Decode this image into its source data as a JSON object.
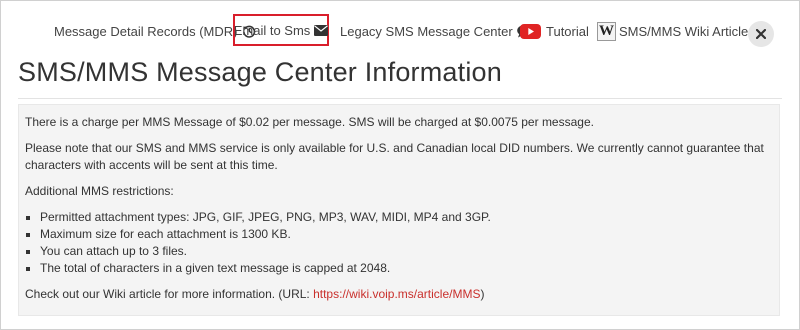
{
  "toolbar": {
    "mdr_label": "Message Detail Records (MDR)",
    "email_label": "Email to Sms",
    "legacy_label": "Legacy SMS Message Center",
    "tutorial_label": "Tutorial",
    "wiki_label": "SMS/MMS Wiki Article",
    "wiki_logo_letter": "W",
    "icons": {
      "mdr": "history-icon",
      "email": "envelope-icon",
      "legacy": "chat-bubble-icon",
      "tutorial": "youtube-icon",
      "wiki": "wikipedia-icon",
      "close": "close-icon"
    },
    "highlight_color": "#d91e2b"
  },
  "page": {
    "title": "SMS/MMS Message Center Information"
  },
  "info": {
    "charge_text": "There is a charge per MMS Message of $0.02 per message. SMS will be charged at $0.0075 per message.",
    "availability_text": "Please note that our SMS and MMS service is only available for U.S. and Canadian local DID numbers. We currently cannot guarantee that characters with accents will be sent at this time.",
    "restrictions_heading": "Additional MMS restrictions:",
    "restrictions": [
      "Permitted attachment types: JPG, GIF, JPEG, PNG, MP3, WAV, MIDI, MP4 and 3GP.",
      "Maximum size for each attachment is 1300 KB.",
      "You can attach up to 3 files.",
      "The total of characters in a given text message is capped at 2048."
    ],
    "wiki_prefix": "Check out our Wiki article for more information. (URL: ",
    "wiki_link": "https://wiki.voip.ms/article/MMS",
    "wiki_suffix": ")",
    "link_color": "#c9302c"
  }
}
